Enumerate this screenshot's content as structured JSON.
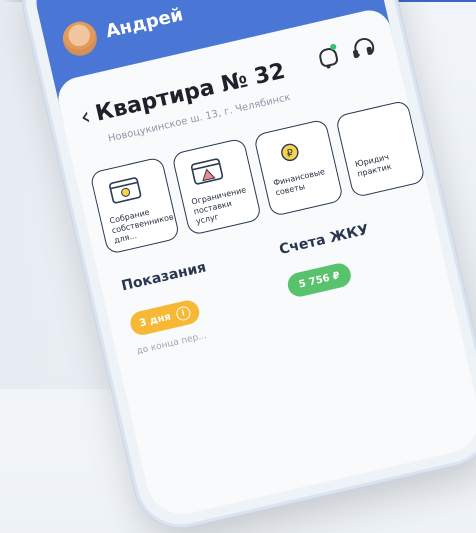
{
  "header": {
    "user_name": "Андрей"
  },
  "main": {
    "title": "Квартира № 32",
    "address": "Новоцукинское ш. 13, г. Челябинск"
  },
  "tiles": [
    {
      "label": "Собрание собственников для..."
    },
    {
      "label": "Ограничение поставки услуг"
    },
    {
      "label": "Финансовые советы"
    },
    {
      "label": "Юридич практик"
    }
  ],
  "readings": {
    "title": "Показания",
    "badge": "3 дня",
    "note": "до конца пер..."
  },
  "bills": {
    "title": "Счета ЖКУ",
    "amount": "5 756 ₽"
  }
}
